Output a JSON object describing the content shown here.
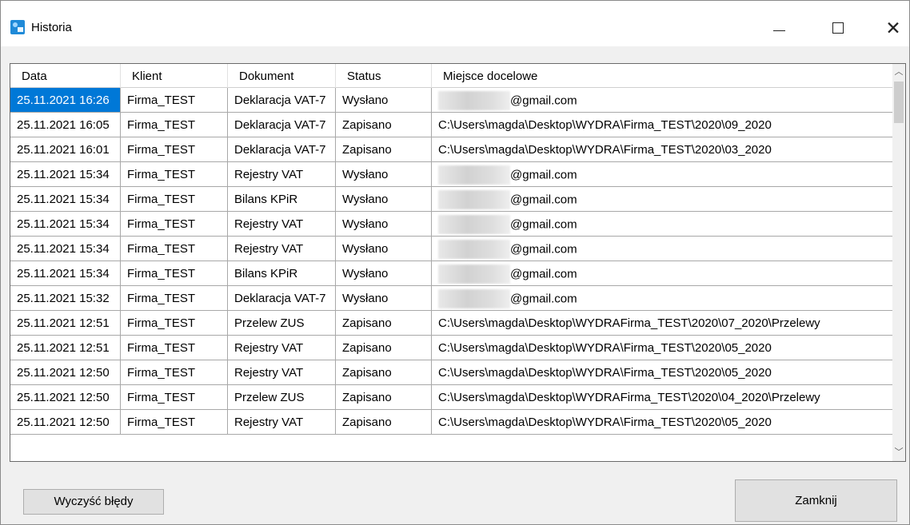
{
  "window": {
    "title": "Historia",
    "icon": "app-icon",
    "controls": {
      "minimize": "minimize-icon",
      "maximize": "maximize-icon",
      "close": "✕"
    }
  },
  "table": {
    "columns": [
      "Data",
      "Klient",
      "Dokument",
      "Status",
      "Miejsce docelowe"
    ],
    "rows": [
      [
        "25.11.2021 16:26",
        "Firma_TEST",
        "Deklaracja VAT-7",
        "Wysłano",
        "@gmail.com"
      ],
      [
        "25.11.2021 16:05",
        "Firma_TEST",
        "Deklaracja VAT-7",
        "Zapisano",
        "C:\\Users\\magda\\Desktop\\WYDRA\\Firma_TEST\\2020\\09_2020"
      ],
      [
        "25.11.2021 16:01",
        "Firma_TEST",
        "Deklaracja VAT-7",
        "Zapisano",
        "C:\\Users\\magda\\Desktop\\WYDRA\\Firma_TEST\\2020\\03_2020"
      ],
      [
        "25.11.2021 15:34",
        "Firma_TEST",
        "Rejestry VAT",
        "Wysłano",
        "@gmail.com"
      ],
      [
        "25.11.2021 15:34",
        "Firma_TEST",
        "Bilans KPiR",
        "Wysłano",
        "@gmail.com"
      ],
      [
        "25.11.2021 15:34",
        "Firma_TEST",
        "Rejestry VAT",
        "Wysłano",
        "@gmail.com"
      ],
      [
        "25.11.2021 15:34",
        "Firma_TEST",
        "Rejestry VAT",
        "Wysłano",
        "@gmail.com"
      ],
      [
        "25.11.2021 15:34",
        "Firma_TEST",
        "Bilans KPiR",
        "Wysłano",
        "@gmail.com"
      ],
      [
        "25.11.2021 15:32",
        "Firma_TEST",
        "Deklaracja VAT-7",
        "Wysłano",
        "@gmail.com"
      ],
      [
        "25.11.2021 12:51",
        "Firma_TEST",
        "Przelew ZUS",
        "Zapisano",
        "C:\\Users\\magda\\Desktop\\WYDRAFirma_TEST\\2020\\07_2020\\Przelewy"
      ],
      [
        "25.11.2021 12:51",
        "Firma_TEST",
        "Rejestry VAT",
        "Zapisano",
        "C:\\Users\\magda\\Desktop\\WYDRA\\Firma_TEST\\2020\\05_2020"
      ],
      [
        "25.11.2021 12:50",
        "Firma_TEST",
        "Rejestry VAT",
        "Zapisano",
        "C:\\Users\\magda\\Desktop\\WYDRA\\Firma_TEST\\2020\\05_2020"
      ],
      [
        "25.11.2021 12:50",
        "Firma_TEST",
        "Przelew ZUS",
        "Zapisano",
        "C:\\Users\\magda\\Desktop\\WYDRAFirma_TEST\\2020\\04_2020\\Przelewy"
      ],
      [
        "25.11.2021 12:50",
        "Firma_TEST",
        "Rejestry VAT",
        "Zapisano",
        "C:\\Users\\magda\\Desktop\\WYDRA\\Firma_TEST\\2020\\05_2020"
      ]
    ],
    "selected_row": 0,
    "selected_column": 0
  },
  "buttons": {
    "clear_errors": "Wyczyść błędy",
    "close": "Zamknij"
  },
  "colors": {
    "selection": "#0078d7",
    "window_bg": "#f0f0f0",
    "grid_bg": "#ffffff",
    "button_bg": "#e1e1e1"
  }
}
